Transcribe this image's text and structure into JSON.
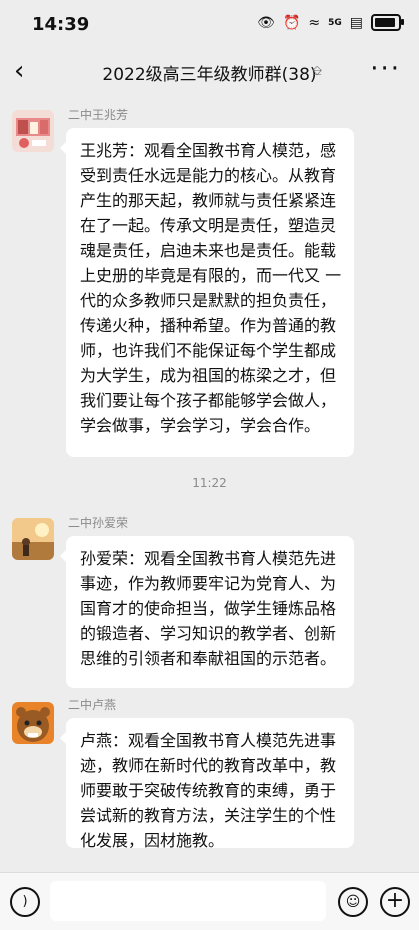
{
  "status": {
    "time": "14:39",
    "network": "5G"
  },
  "header": {
    "title": "2022级高三年级教师群(38)"
  },
  "messages": [
    {
      "sender": "二中王兆芳",
      "text": "王兆芳：观看全国教书育人模范，感受到责任水远是能力的核心。从教育产生的那天起，教师就与责任紧紧连在了一起。传承文明是责任，塑造灵魂是责任，启迪未来也是责任。能载上史册的毕竟是有限的，而一代又 一代的众多教师只是默默的担负责任， 传递火种，播种希望。作为普通的教师，也许我们不能保证每个学生都成为大学生，成为祖国的栋梁之才，但我们要让每个孩子都能够学会做人，学会做事，学会学习，学会合作。"
    },
    {
      "sender": "二中孙爱荣",
      "text": "孙爱荣：观看全国教书育人模范先进事迹，作为教师要牢记为党育人、为国育才的使命担当，做学生锤炼品格的锻造者、学习知识的教学者、创新思维的引领者和奉献祖国的示范者。"
    },
    {
      "sender": "二中卢燕",
      "text": "卢燕：观看全国教书育人模范先进事迹，教师在新时代的教育改革中，教师要敢于突破传统教育的束缚，勇于尝试新的教育方法，关注学生的个性化发展，因材施教。"
    }
  ],
  "timestamp": "11:22"
}
